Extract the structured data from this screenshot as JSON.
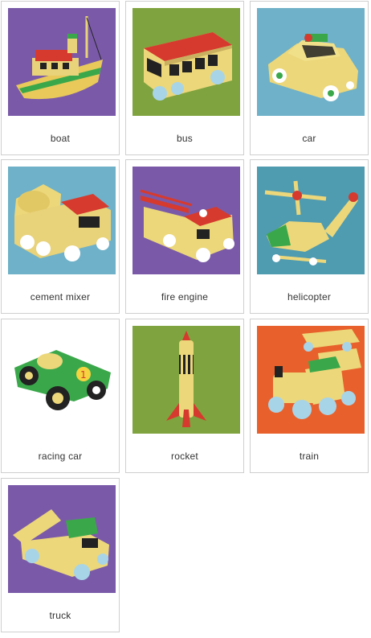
{
  "cards": [
    {
      "label": "boat",
      "picture": "toy-boat",
      "background": "#7a5aa8"
    },
    {
      "label": "bus",
      "picture": "toy-bus",
      "background": "#7fa33e"
    },
    {
      "label": "car",
      "picture": "toy-car",
      "background": "#6fb1c8"
    },
    {
      "label": "cement mixer",
      "picture": "toy-cement-mixer",
      "background": "#6fb1c8"
    },
    {
      "label": "fire engine",
      "picture": "toy-fire-engine",
      "background": "#7a5aa8"
    },
    {
      "label": "helicopter",
      "picture": "toy-helicopter",
      "background": "#4f9bb0"
    },
    {
      "label": "racing car",
      "picture": "toy-racing-car",
      "background": "#ffffff"
    },
    {
      "label": "rocket",
      "picture": "toy-rocket",
      "background": "#7fa33e"
    },
    {
      "label": "train",
      "picture": "toy-train",
      "background": "#e8612c"
    },
    {
      "label": "truck",
      "picture": "toy-truck",
      "background": "#7a5aa8"
    }
  ]
}
